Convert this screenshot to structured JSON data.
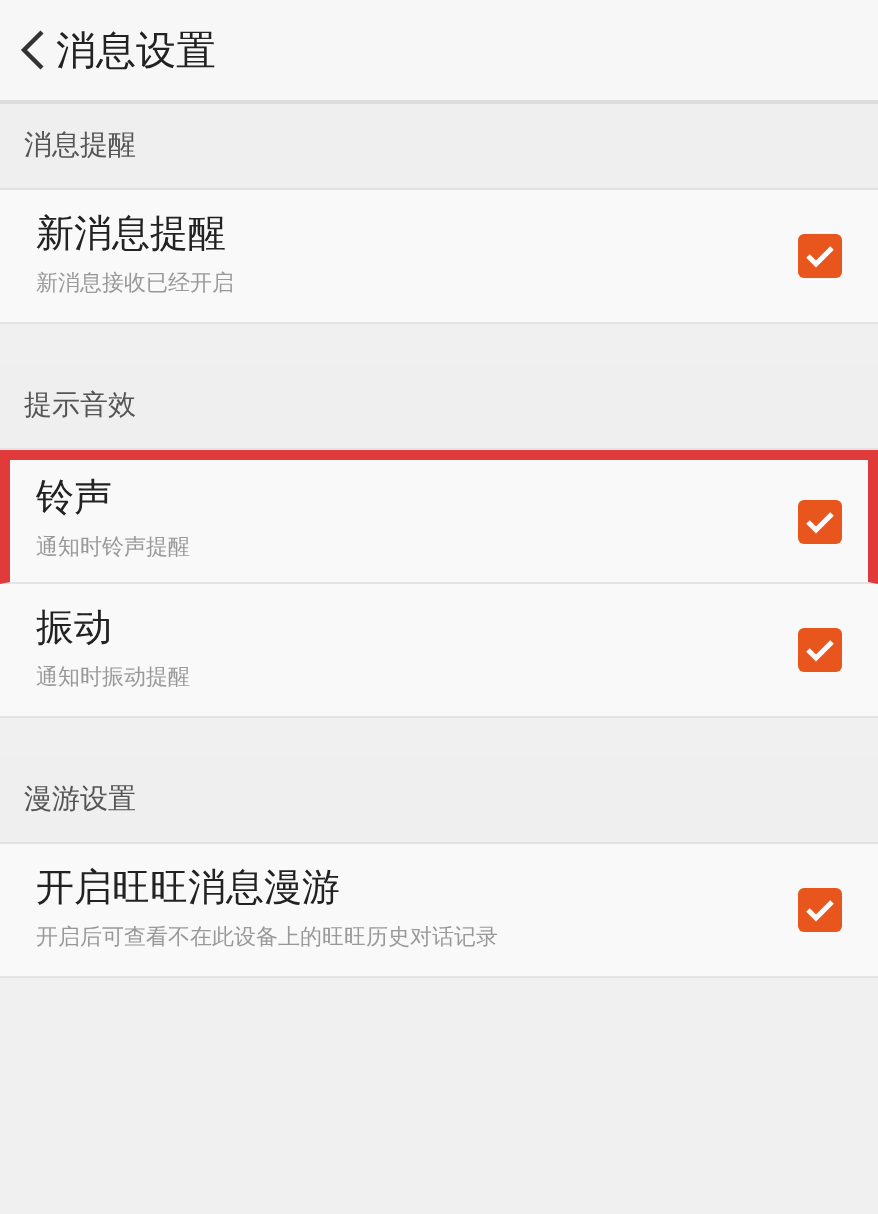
{
  "header": {
    "title": "消息设置"
  },
  "sections": [
    {
      "title": "消息提醒",
      "items": [
        {
          "title": "新消息提醒",
          "subtitle": "新消息接收已经开启",
          "checked": true,
          "highlighted": false
        }
      ]
    },
    {
      "title": "提示音效",
      "items": [
        {
          "title": "铃声",
          "subtitle": "通知时铃声提醒",
          "checked": true,
          "highlighted": true
        },
        {
          "title": "振动",
          "subtitle": "通知时振动提醒",
          "checked": true,
          "highlighted": false
        }
      ]
    },
    {
      "title": "漫游设置",
      "items": [
        {
          "title": "开启旺旺消息漫游",
          "subtitle": "开启后可查看不在此设备上的旺旺历史对话记录",
          "checked": true,
          "highlighted": false
        }
      ]
    }
  ]
}
